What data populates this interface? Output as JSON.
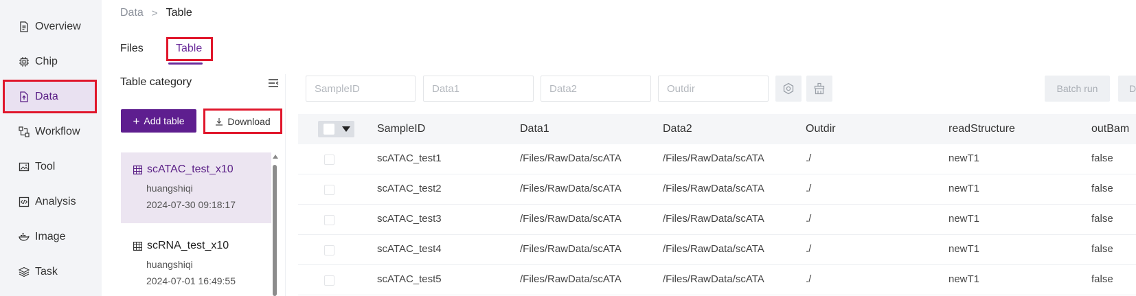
{
  "sidebar": {
    "items": [
      {
        "label": "Overview",
        "icon": "document-icon"
      },
      {
        "label": "Chip",
        "icon": "chip-icon"
      },
      {
        "label": "Data",
        "icon": "file-upload-icon"
      },
      {
        "label": "Workflow",
        "icon": "workflow-icon"
      },
      {
        "label": "Tool",
        "icon": "image-tool-icon"
      },
      {
        "label": "Analysis",
        "icon": "code-icon"
      },
      {
        "label": "Image",
        "icon": "docker-icon"
      },
      {
        "label": "Task",
        "icon": "layers-icon"
      }
    ],
    "active_index": 2
  },
  "breadcrumb": {
    "parent": "Data",
    "separator": ">",
    "current": "Table"
  },
  "tabs": [
    {
      "label": "Files"
    },
    {
      "label": "Table"
    }
  ],
  "left_panel": {
    "title": "Table category",
    "add_label": "Add table",
    "download_label": "Download",
    "categories": [
      {
        "name": "scATAC_test_x10",
        "user": "huangshiqi",
        "time": "2024-07-30 09:18:17"
      },
      {
        "name": "scRNA_test_x10",
        "user": "huangshiqi",
        "time": "2024-07-01 16:49:55"
      }
    ]
  },
  "filters": {
    "sampleid": "SampleID",
    "data1": "Data1",
    "data2": "Data2",
    "outdir": "Outdir",
    "batch_run": "Batch run",
    "truncated_button": "D"
  },
  "table": {
    "columns": [
      "SampleID",
      "Data1",
      "Data2",
      "Outdir",
      "readStructure",
      "outBam"
    ],
    "rows": [
      [
        "scATAC_test1",
        "/Files/RawData/scATA",
        "/Files/RawData/scATA",
        "./",
        "newT1",
        "false"
      ],
      [
        "scATAC_test2",
        "/Files/RawData/scATA",
        "/Files/RawData/scATA",
        "./",
        "newT1",
        "false"
      ],
      [
        "scATAC_test3",
        "/Files/RawData/scATA",
        "/Files/RawData/scATA",
        "./",
        "newT1",
        "false"
      ],
      [
        "scATAC_test4",
        "/Files/RawData/scATA",
        "/Files/RawData/scATA",
        "./",
        "newT1",
        "false"
      ],
      [
        "scATAC_test5",
        "/Files/RawData/scATA",
        "/Files/RawData/scATA",
        "./",
        "newT1",
        "false"
      ]
    ]
  },
  "colors": {
    "accent": "#5e1e8f",
    "highlight_border": "#e0162b",
    "selected_bg": "#ece5f1"
  }
}
